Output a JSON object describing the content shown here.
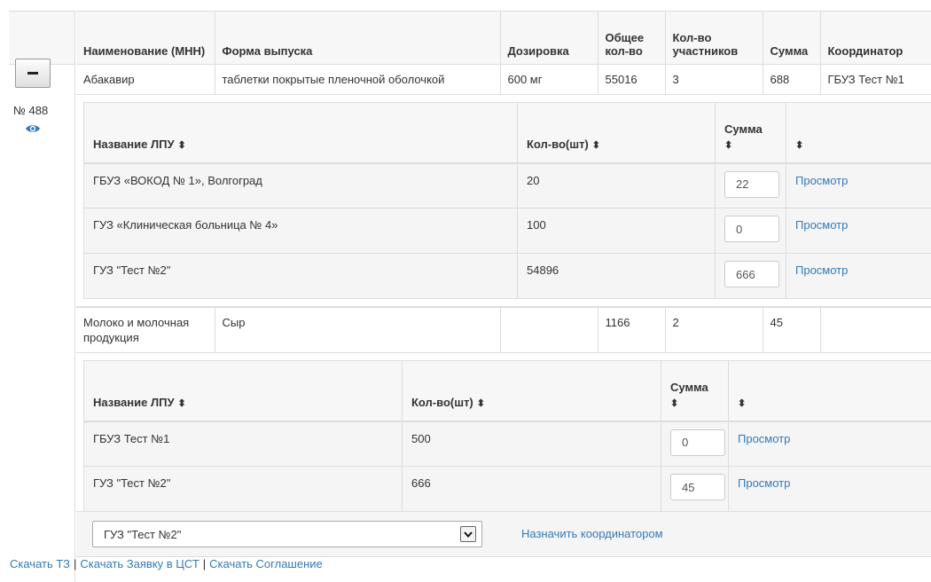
{
  "header": {
    "col_name": "Наименование (МНН)",
    "col_form": "Форма выпуска",
    "col_dose": "Дозировка",
    "col_total": "Общее кол-во",
    "col_participants": "Кол-во участников",
    "col_sum": "Сумма",
    "col_coordinator": "Координатор"
  },
  "order": {
    "number": "№ 488"
  },
  "items": [
    {
      "name": "Абакавир",
      "form": "таблетки покрытые пленочной оболочкой",
      "dose": "600 мг",
      "total": "55016",
      "participants": "3",
      "sum": "688",
      "coordinator": "ГБУЗ Тест №1",
      "sub_headers": {
        "lpu": "Название ЛПУ",
        "qty": "Кол-во(шт)",
        "sum": "Сумма"
      },
      "rows": [
        {
          "lpu": "ГБУЗ «ВОКОД № 1», Волгоград",
          "qty": "20",
          "sum": "22",
          "view": "Просмотр"
        },
        {
          "lpu": "ГУЗ «Клиническая больница № 4»",
          "qty": "100",
          "sum": "0",
          "view": "Просмотр"
        },
        {
          "lpu": "ГУЗ \"Тест №2\"",
          "qty": "54896",
          "sum": "666",
          "view": "Просмотр"
        }
      ]
    },
    {
      "name": "Молоко и молочная продукция",
      "form": "Сыр",
      "dose": "",
      "total": "1166",
      "participants": "2",
      "sum": "45",
      "coordinator": "",
      "sub_headers": {
        "lpu": "Название ЛПУ",
        "qty": "Кол-во(шт)",
        "sum": "Сумма"
      },
      "rows": [
        {
          "lpu": "ГБУЗ Тест №1",
          "qty": "500",
          "sum": "0",
          "view": "Просмотр"
        },
        {
          "lpu": "ГУЗ \"Тест №2\"",
          "qty": "666",
          "sum": "45",
          "view": "Просмотр"
        }
      ]
    }
  ],
  "coordinator_bar": {
    "selected": "ГУЗ \"Тест №2\"",
    "assign_label": "Назначить координатором"
  },
  "downloads": {
    "tz": "Скачать ТЗ",
    "request": "Скачать Заявку в ЦСТ",
    "agreement": "Скачать Соглашение"
  },
  "colors": {
    "link": "#337ab7",
    "border": "#dddddd",
    "header_bg": "#f7f7f7",
    "sub_bg": "#f5f5f5"
  },
  "icons": {
    "eye": "eye-icon",
    "sort": "sort-icon",
    "collapse": "minus-icon",
    "dropdown": "chevron-down-icon"
  }
}
